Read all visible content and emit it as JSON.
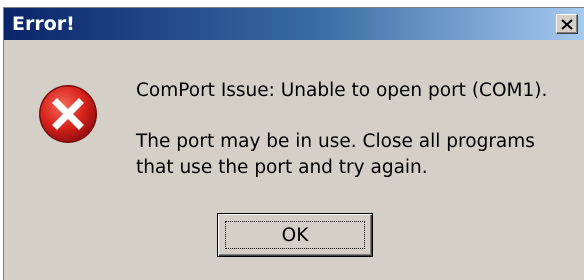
{
  "window": {
    "title": "Error!",
    "close_icon": "close-icon"
  },
  "message": {
    "icon": "error-icon",
    "line1": "ComPort Issue: Unable to open port (COM1).",
    "line2": "The port may be in use. Close all programs",
    "line3": "that use the port and try again."
  },
  "buttons": {
    "ok_label": "OK"
  },
  "colors": {
    "titlebar_start": "#0a246a",
    "titlebar_end": "#a6caf0",
    "dialog_face": "#d4d0c8",
    "error_red": "#d9241c"
  }
}
